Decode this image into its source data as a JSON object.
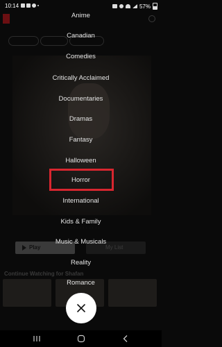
{
  "status_bar": {
    "time": "10:14",
    "battery": "57%",
    "icons": [
      "image-icon",
      "square-icon",
      "alarm-icon",
      "dot-icon",
      "mute-icon",
      "alarm-clock-icon",
      "wifi-icon",
      "signal-icon",
      "battery-icon"
    ]
  },
  "background": {
    "play_label": "Play",
    "mylist_label": "My List",
    "row_title": "Continue Watching for Shafan"
  },
  "menu": {
    "items": [
      "Anime",
      "Canadian",
      "Comedies",
      "Critically Acclaimed",
      "Documentaries",
      "Dramas",
      "Fantasy",
      "Halloween",
      "Horror",
      "International",
      "Kids & Family",
      "Music & Musicals",
      "Reality",
      "Romance"
    ],
    "highlighted": "Horror"
  },
  "close_button": {
    "icon": "close-icon"
  },
  "nav_bar": {
    "icons": [
      "recents-icon",
      "home-icon",
      "back-icon"
    ]
  },
  "colors": {
    "highlight": "#d8262f",
    "text": "#e6e6e6",
    "background": "#0a0a0a"
  }
}
